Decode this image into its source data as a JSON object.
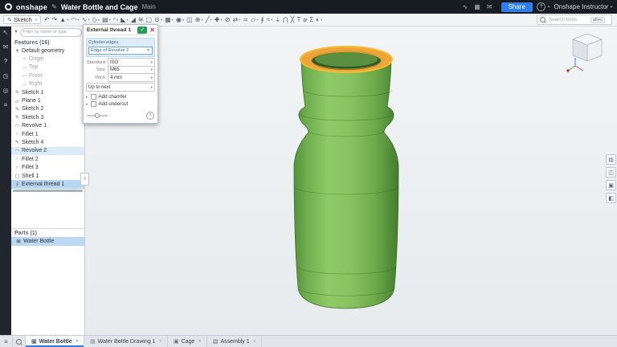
{
  "colors": {
    "accent": "#2d7ff0",
    "bottle-green": "#86c05c",
    "bottle-green-dark": "#4f8a33",
    "thread-orange": "#eda43b",
    "selection-blue": "#bcd8f5"
  },
  "topbar": {
    "brand": "onshape",
    "edit_glyph": "✎",
    "document_title": "Water Bottle and Cage",
    "branch": "Main",
    "share_label": "Share",
    "help_glyph": "?",
    "user": "Onshape Instructor",
    "right_icons": [
      {
        "name": "analytics-icon",
        "glyph": "∿"
      },
      {
        "name": "apps-grid-icon",
        "glyph": "▦"
      },
      {
        "name": "comments-icon",
        "glyph": "✉"
      }
    ]
  },
  "toolbar": {
    "sketch_glyph": "✎",
    "sketch_label": "Sketch",
    "search_placeholder": "Search tools",
    "search_shortcut": "alt+c",
    "icons": [
      {
        "name": "undo-icon",
        "glyph": "↶"
      },
      {
        "name": "redo-icon",
        "glyph": "↷"
      },
      {
        "name": "extrude-icon",
        "glyph": "▲",
        "caret": true
      },
      {
        "name": "revolve-icon",
        "glyph": "◠",
        "caret": true
      },
      {
        "name": "sweep-icon",
        "glyph": "∿",
        "caret": true
      },
      {
        "name": "loft-icon",
        "glyph": "◇",
        "caret": true
      },
      {
        "name": "thicken-icon",
        "glyph": "▤",
        "caret": true
      },
      {
        "name": "fillet-icon",
        "glyph": "◜",
        "caret": true
      },
      {
        "name": "chamfer-icon",
        "glyph": "◣",
        "caret": true
      },
      {
        "name": "draft-icon",
        "glyph": "◢"
      },
      {
        "name": "rib-icon",
        "glyph": "≋"
      },
      {
        "name": "shell-icon",
        "glyph": "▢"
      },
      {
        "name": "hole-icon",
        "glyph": "⊙",
        "caret": true
      },
      {
        "name": "linear-pattern-icon",
        "glyph": "▦",
        "caret": true
      },
      {
        "name": "circular-pattern-icon",
        "glyph": "◉",
        "caret": true
      },
      {
        "name": "mirror-icon",
        "glyph": "◫"
      },
      {
        "name": "boolean-icon",
        "glyph": "⊕",
        "caret": true
      },
      {
        "name": "split-icon",
        "glyph": "╱",
        "caret": true
      },
      {
        "name": "transform-icon",
        "glyph": "✚",
        "caret": true
      },
      {
        "name": "delete-part-icon",
        "glyph": "⊘"
      },
      {
        "name": "move-face-icon",
        "glyph": "⇄",
        "caret": true
      },
      {
        "name": "offset-surface-icon",
        "glyph": "≍"
      },
      {
        "name": "plane-icon",
        "glyph": "▱",
        "caret": true
      },
      {
        "name": "helix-icon",
        "glyph": "∮"
      },
      {
        "name": "spline-icon",
        "glyph": "≈",
        "caret": true
      },
      {
        "name": "project-curve-icon",
        "glyph": "⇣"
      },
      {
        "name": "intersection-curve-icon",
        "glyph": "⋂"
      },
      {
        "name": "trim-curve-icon",
        "glyph": "╳"
      },
      {
        "name": "text-tool-icon",
        "glyph": "T"
      },
      {
        "name": "measure-icon",
        "glyph": "⌀"
      },
      {
        "name": "mass-properties-icon",
        "glyph": "Σ"
      },
      {
        "name": "appearance-icon",
        "glyph": "◐",
        "caret": true
      }
    ]
  },
  "leftstrip": {
    "icons": [
      {
        "name": "select-tool-icon",
        "glyph": "↖"
      },
      {
        "name": "comments-panel-icon",
        "glyph": "✉"
      },
      {
        "name": "help-panel-icon",
        "glyph": "?"
      },
      {
        "name": "history-panel-icon",
        "glyph": "◷"
      },
      {
        "name": "follow-mode-icon",
        "glyph": "◎"
      },
      {
        "name": "feature-list-icon",
        "glyph": "≡"
      }
    ]
  },
  "panel": {
    "filter_placeholder": "Filter by name or type",
    "features_header": "Features (16)",
    "tree": [
      {
        "name": "tree-item-default-geometry",
        "label": "Default geometry",
        "icon": "▾"
      },
      {
        "name": "tree-item-origin",
        "label": "Origin",
        "icon": "⌖",
        "indent": 1,
        "dim": true
      },
      {
        "name": "tree-item-top",
        "label": "Top",
        "icon": "▱",
        "indent": 1,
        "dim": true
      },
      {
        "name": "tree-item-front",
        "label": "Front",
        "icon": "▱",
        "indent": 1,
        "dim": true
      },
      {
        "name": "tree-item-right",
        "label": "Right",
        "icon": "▱",
        "indent": 1,
        "dim": true
      },
      {
        "name": "tree-item-sketch-1",
        "label": "Sketch 1",
        "icon": "✎"
      },
      {
        "name": "tree-item-plane-1",
        "label": "Plane 1",
        "icon": "▱"
      },
      {
        "name": "tree-item-sketch-2",
        "label": "Sketch 2",
        "icon": "✎"
      },
      {
        "name": "tree-item-sketch-3",
        "label": "Sketch 3",
        "icon": "✎"
      },
      {
        "name": "tree-item-revolve-1",
        "label": "Revolve 1",
        "icon": "◠"
      },
      {
        "name": "tree-item-fillet-1",
        "label": "Fillet 1",
        "icon": "◜"
      },
      {
        "name": "tree-item-sketch-4",
        "label": "Sketch 4",
        "icon": "✎"
      },
      {
        "name": "tree-item-revolve-2",
        "label": "Revolve 2",
        "icon": "◠",
        "selected": true
      },
      {
        "name": "tree-item-fillet-2",
        "label": "Fillet 2",
        "icon": "◜"
      },
      {
        "name": "tree-item-fillet-3",
        "label": "Fillet 3",
        "icon": "◜"
      },
      {
        "name": "tree-item-shell-1",
        "label": "Shell 1",
        "icon": "▢"
      },
      {
        "name": "tree-item-external-thread-1",
        "label": "External thread 1",
        "icon": "∮",
        "editing": true
      }
    ],
    "parts_header": "Parts (1)",
    "parts": [
      {
        "name": "part-item-water-bottle",
        "label": "Water Bottle",
        "icon": "▣"
      }
    ]
  },
  "dialog": {
    "title": "External thread 1",
    "ok_glyph": "✓",
    "cancel_glyph": "✕",
    "selection_label": "Cylinder edges",
    "selection_chip": "Edge of Revolve 2",
    "chip_remove_glyph": "✕",
    "rows": [
      {
        "name": "thread-standard-row",
        "label": "Standard",
        "value": "ISO"
      },
      {
        "name": "thread-size-row",
        "label": "Size",
        "value": "M65"
      },
      {
        "name": "thread-pitch-row",
        "label": "Pitch",
        "value": "4 mm"
      }
    ],
    "end_condition": "Up to next",
    "toggles": [
      {
        "name": "add-chamfer-toggle",
        "label": "Add chamfer"
      },
      {
        "name": "add-undercut-toggle",
        "label": "Add undercut"
      }
    ],
    "help_glyph": "?"
  },
  "viewport_tools": [
    {
      "name": "view-settings-icon",
      "glyph": "▤"
    },
    {
      "name": "section-view-icon",
      "glyph": "◫"
    },
    {
      "name": "isolate-icon",
      "glyph": "▣"
    },
    {
      "name": "display-options-icon",
      "glyph": "◧"
    }
  ],
  "bottombar": {
    "tab_manager_glyph": "≡",
    "tabs": [
      {
        "name": "tab-water-bottle",
        "label": "Water Bottle",
        "glyph": "▣",
        "active": true
      },
      {
        "name": "tab-water-bottle-drawing-1",
        "label": "Water Bottle Drawing 1",
        "glyph": "▤"
      },
      {
        "name": "tab-cage",
        "label": "Cage",
        "glyph": "▣"
      },
      {
        "name": "tab-assembly-1",
        "label": "Assembly 1",
        "glyph": "▧"
      }
    ]
  }
}
